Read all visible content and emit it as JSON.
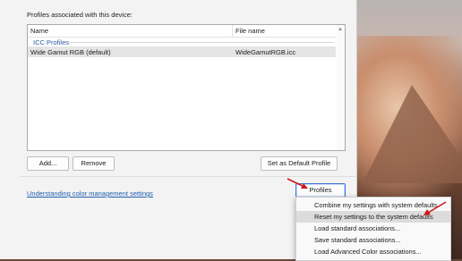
{
  "profiles_section": {
    "label": "Profiles associated with this device:"
  },
  "profile_list": {
    "columns": [
      "Name",
      "File name"
    ],
    "group_header": "ICC Profiles",
    "rows": [
      {
        "name": "Wide Gamut RGB (default)",
        "file": "WideGamutRGB.icc",
        "selected": true
      }
    ]
  },
  "buttons": {
    "add": "Add...",
    "remove": "Remove",
    "set_default": "Set as Default Profile",
    "profiles": "Profiles"
  },
  "link": {
    "text": "Understanding color management settings"
  },
  "profiles_menu": {
    "items": [
      "Combine my settings with system defaults",
      "Reset my settings to the system defaults",
      "Load standard associations...",
      "Save standard associations...",
      "Load Advanced Color associations..."
    ],
    "highlighted_index": 1
  },
  "annotation_color": "#d0161b"
}
